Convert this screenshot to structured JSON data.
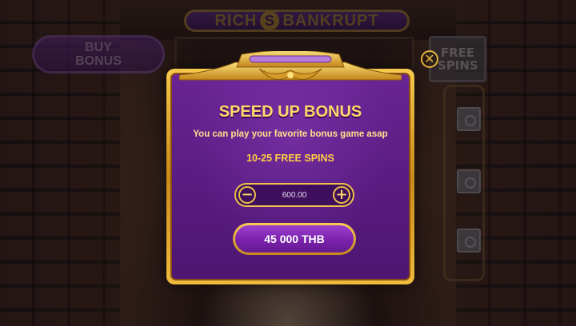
{
  "background": {
    "logo": {
      "left": "RICH",
      "right": "BANKRUPT",
      "mark": "S"
    },
    "buy_bonus_label": "BUY BONUS",
    "free_spins_label": "FREE SPINS"
  },
  "dialog": {
    "title": "SPEED UP BONUS",
    "subtitle": "You can play your favorite bonus game asap",
    "spins_range": "10-25 FREE SPINS",
    "bet": {
      "value": "600.00",
      "decrease_icon": "minus-icon",
      "increase_icon": "plus-icon",
      "decrease_symbol": "−",
      "increase_symbol": "+"
    },
    "price_label": "45 000 THB",
    "close_symbol": "✕",
    "close_icon": "close-icon"
  },
  "colors": {
    "gold": "#f0c04a",
    "purple": "#5a1c82",
    "title_gold": "#ffd769"
  }
}
